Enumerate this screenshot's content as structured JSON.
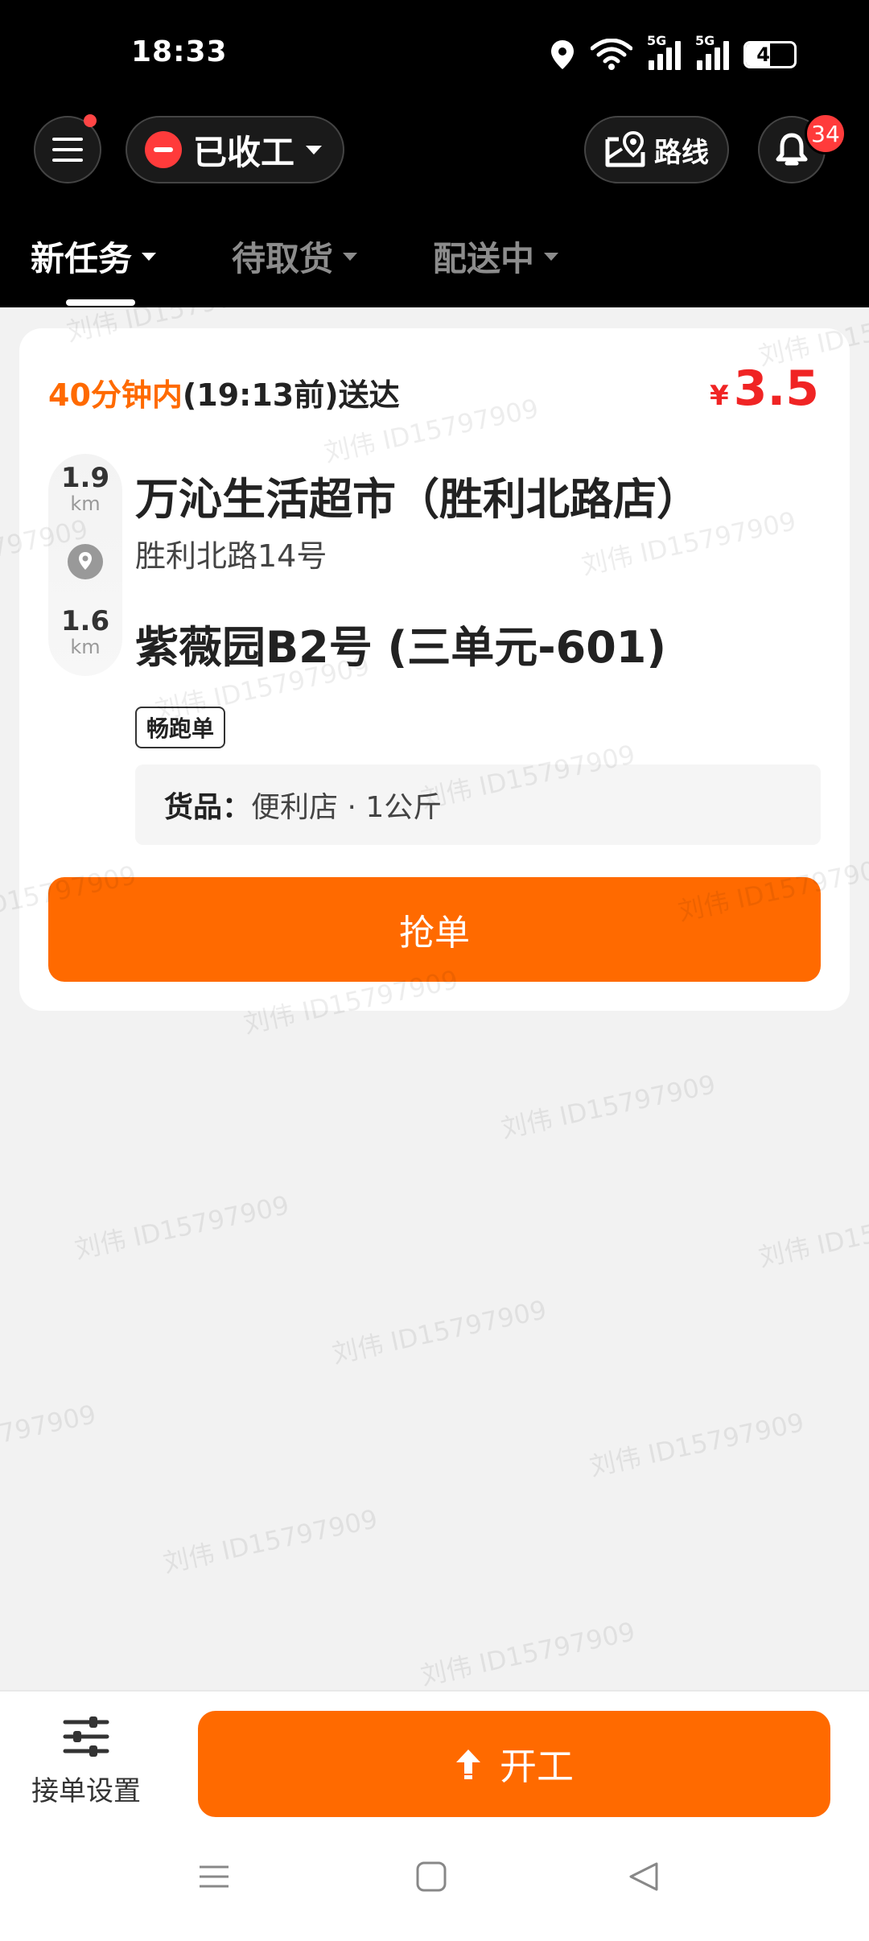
{
  "status_bar": {
    "time": "18:33",
    "signal_label": "5G",
    "battery": "49"
  },
  "header": {
    "work_status": "已收工",
    "route_label": "路线",
    "notification_count": "34"
  },
  "tabs": [
    {
      "label": "新任务",
      "active": true
    },
    {
      "label": "待取货",
      "active": false
    },
    {
      "label": "配送中",
      "active": false
    }
  ],
  "order": {
    "deadline_highlight": "40分钟内",
    "deadline_rest": "(19:13前)送达",
    "price_currency": "¥",
    "price": "3.5",
    "pickup_distance": "1.9",
    "pickup_unit": "km",
    "delivery_distance": "1.6",
    "delivery_unit": "km",
    "store_name": "万沁生活超市（胜利北路店）",
    "store_address": "胜利北路14号",
    "destination": "紫薇园B2号 (三单元-601)",
    "tag": "畅跑单",
    "goods_label": "货品：",
    "goods_value": "便利店 · 1公斤",
    "grab_label": "抢单"
  },
  "watermark": "刘伟 ID15797909",
  "bottom": {
    "settings_label": "接单设置",
    "start_label": "开工"
  },
  "colors": {
    "accent": "#ff6a00",
    "price": "#f02424",
    "badge": "#ff3b3b"
  }
}
